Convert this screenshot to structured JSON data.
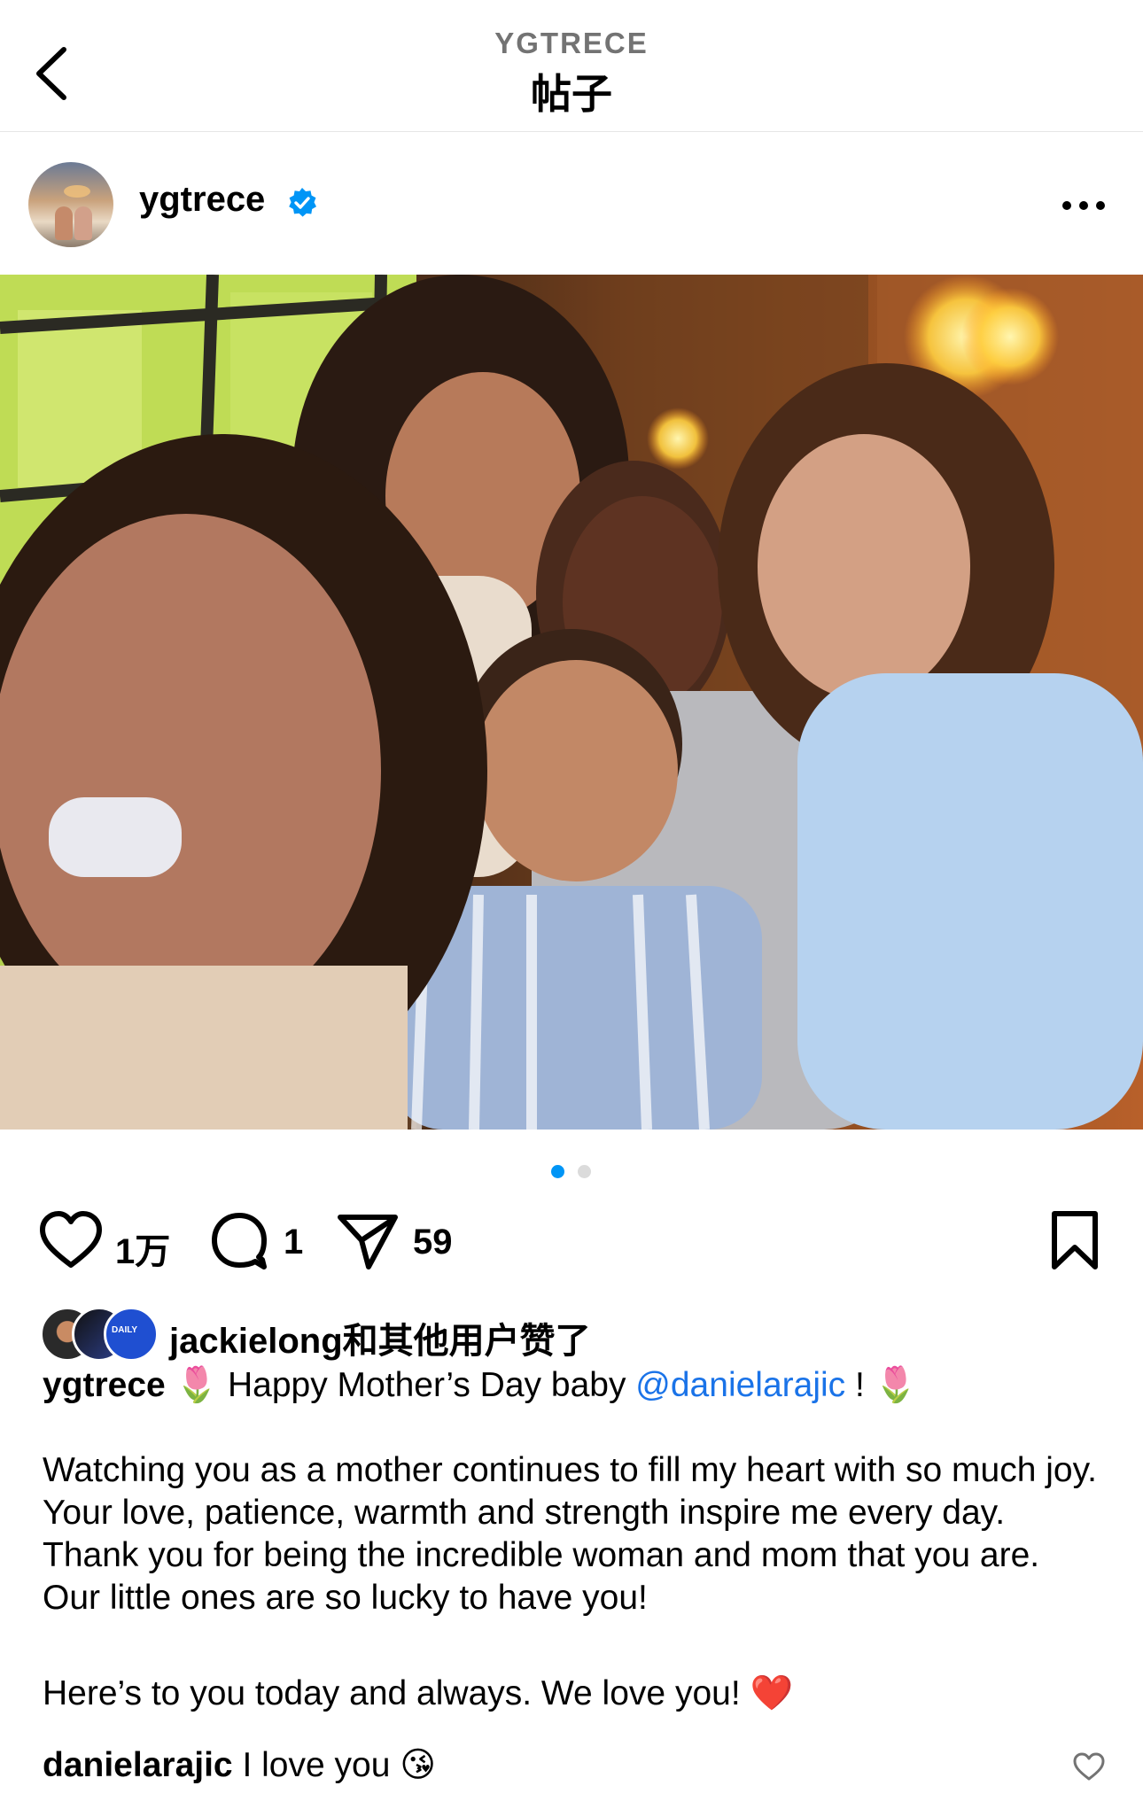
{
  "header": {
    "subtitle": "YGTRECE",
    "title": "帖子"
  },
  "post": {
    "author": "ygtrece",
    "image_dots": {
      "count": 2,
      "active_index": 0
    }
  },
  "actions": {
    "like_count": "1万",
    "comment_count": "1",
    "share_count": "59"
  },
  "likes": {
    "text_user": "jackielong",
    "text_suffix": "和其他用户赞了",
    "avatar_badge": "DAILY"
  },
  "caption": {
    "user": "ygtrece",
    "emoji_1": "🌷",
    "line1_text": " Happy Mother’s Day baby ",
    "mention": "@danielarajic",
    "line1_end": " ! ",
    "emoji_2": "🌷",
    "paragraph_2": "Watching you as a mother continues to fill my heart with so much joy. Your love, patience, warmth and strength inspire me every day. Thank you for being the incredible woman and mom that you are. Our little ones are so lucky to have you!",
    "paragraph_3": "Here’s to you today and always. We love you! ",
    "heart_emoji": "❤️"
  },
  "comment": {
    "user": "danielarajic",
    "text": " I love you ",
    "emoji": "😘"
  },
  "colors": {
    "accent_blue": "#0095f6",
    "verified_blue": "#0095f6",
    "muted_gray": "#737373"
  }
}
